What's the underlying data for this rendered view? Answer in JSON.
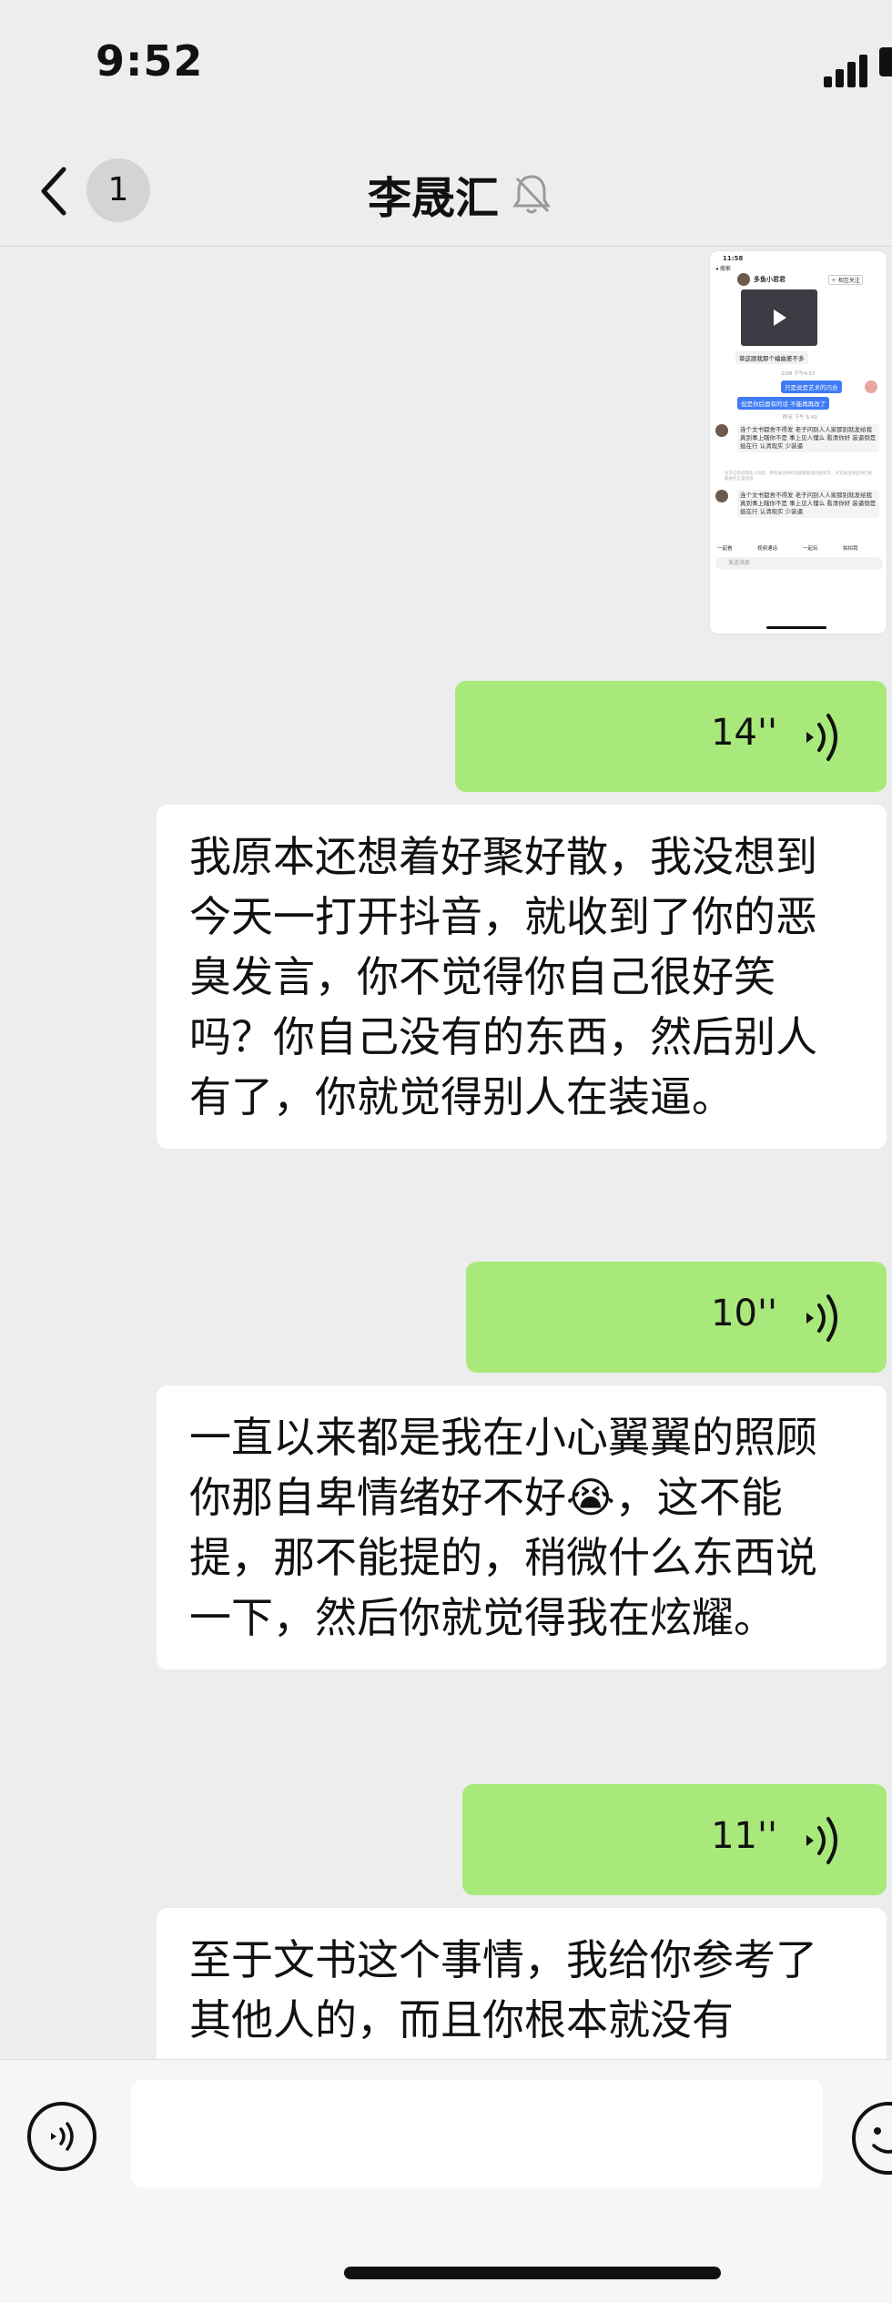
{
  "status_bar": {
    "time": "9:52"
  },
  "header": {
    "back_badge": "1",
    "title": "李晟汇"
  },
  "screenshot_message": {
    "time": "11:58",
    "back_label": "◂ 搜索",
    "name": "多鱼小君君",
    "follow_label": "＋ 相互关注",
    "video_caption": "草这跟我那个编曲差不多",
    "stamp1": "2/08 下午4:57",
    "sent1": "只是说是艺术的巧合",
    "sent2": "但是你后面有的话 不能再再改了",
    "stamp2": "昨天 下午 6:43",
    "para1": "连个文书都舍不得发 老子问别人人家那别就发给我 真到事上瞎你不是 事上见人懂么 看清你好 装逼倒是挺在行 认清现实 少装逼",
    "notice": "对方已开启陌生人消息，所有关注你的消息都会送达给对方，对方关注你后你们将能进行正常对话",
    "para2": "连个文书都舍不得发 老子问别人人家那别就发给我 真到事上瞎你不是 事上见人懂么 看清你好 装逼倒是挺在行 认清现实 少装逼",
    "actions": [
      "一起看",
      "视频通话",
      "一起玩",
      "拍拍我"
    ],
    "input_placeholder": "发送消息"
  },
  "messages": [
    {
      "type": "voice",
      "direction": "out",
      "duration": "14''"
    },
    {
      "type": "text",
      "direction": "in",
      "text": "我原本还想着好聚好散，我没想到今天一打开抖音，就收到了你的恶臭发言，你不觉得你自己很好笑吗？你自己没有的东西，然后别人有了，你就觉得别人在装逼。"
    },
    {
      "type": "voice",
      "direction": "out",
      "duration": "10''"
    },
    {
      "type": "text",
      "direction": "in",
      "text": "一直以来都是我在小心翼翼的照顾你那自卑情绪好不好😭，这不能提，那不能提的，稍微什么东西说一下，然后你就觉得我在炫耀。"
    },
    {
      "type": "voice",
      "direction": "out",
      "duration": "11''"
    },
    {
      "type": "text",
      "direction": "in",
      "text": "至于文书这个事情，我给你参考了其他人的，而且你根本就没有"
    }
  ],
  "input_bar": {
    "value": ""
  },
  "icons": {
    "back": "chevron-left-icon",
    "mute": "bell-off-icon",
    "voice_wave": "voice-wave-icon",
    "voice_toggle": "voice-input-icon",
    "emoji": "emoji-icon"
  },
  "colors": {
    "background": "#ededed",
    "outgoing_bubble": "#a9e87a",
    "incoming_bubble": "#ffffff"
  }
}
